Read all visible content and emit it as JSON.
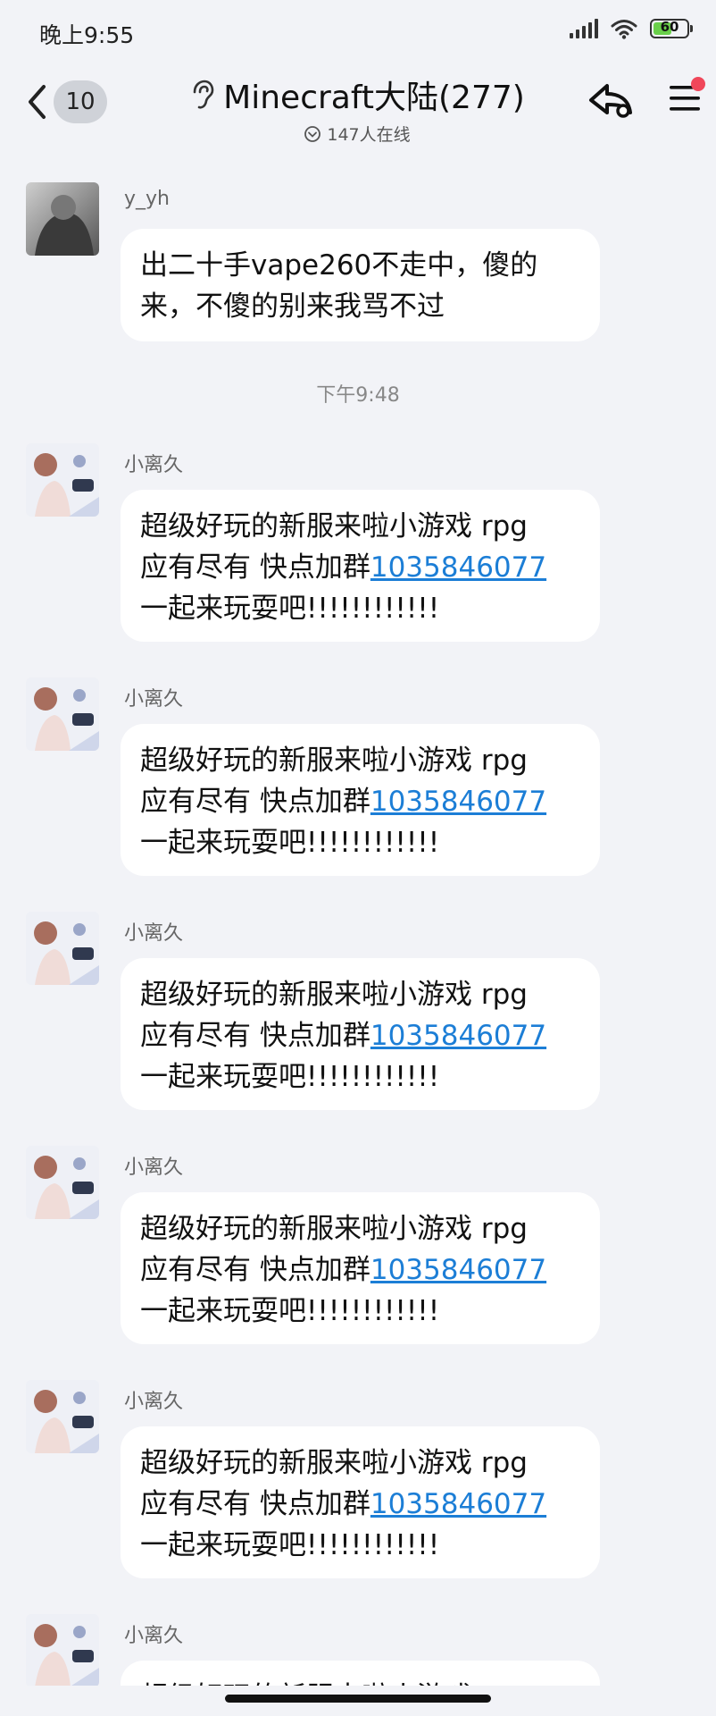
{
  "status_bar": {
    "time": "晚上9:55",
    "battery_level": "60",
    "battery_fraction": 0.6,
    "icons": [
      "signal-icon",
      "wifi-icon",
      "battery-icon"
    ]
  },
  "header": {
    "unread_count": "10",
    "title": "Minecraft大陆(277)",
    "online_text": "147人在线",
    "icons": [
      "back-icon",
      "ear-icon",
      "online-chevron-icon",
      "share-icon",
      "menu-icon"
    ]
  },
  "colors": {
    "background": "#f2f3f7",
    "bubble": "#ffffff",
    "link": "#1c7ed6",
    "notification_dot": "#f0475a",
    "battery": "#6ad04a"
  },
  "messages": [
    {
      "sender": "y_yh",
      "text": "出二十手vape260不走中，傻的来，不傻的别来我骂不过"
    },
    {
      "time_divider": "下午9:48"
    },
    {
      "sender": "小离久",
      "line1": "超级好玩的新服来啦小游戏 rpg",
      "line2_prefix": "应有尽有 快点加群",
      "link": "1035846077",
      "line3": "一起来玩耍吧!!!!!!!!!!!!"
    },
    {
      "sender": "小离久",
      "line1": "超级好玩的新服来啦小游戏 rpg",
      "line2_prefix": "应有尽有 快点加群",
      "link": "1035846077",
      "line3": "一起来玩耍吧!!!!!!!!!!!!"
    },
    {
      "sender": "小离久",
      "line1": "超级好玩的新服来啦小游戏 rpg",
      "line2_prefix": "应有尽有 快点加群",
      "link": "1035846077",
      "line3": "一起来玩耍吧!!!!!!!!!!!!"
    },
    {
      "sender": "小离久",
      "line1": "超级好玩的新服来啦小游戏 rpg",
      "line2_prefix": "应有尽有 快点加群",
      "link": "1035846077",
      "line3": "一起来玩耍吧!!!!!!!!!!!!"
    },
    {
      "sender": "小离久",
      "line1": "超级好玩的新服来啦小游戏 rpg",
      "line2_prefix": "应有尽有 快点加群",
      "link": "1035846077",
      "line3": "一起来玩耍吧!!!!!!!!!!!!"
    },
    {
      "sender": "小离久",
      "line1": "超级好玩的新服来啦小游戏"
    }
  ]
}
